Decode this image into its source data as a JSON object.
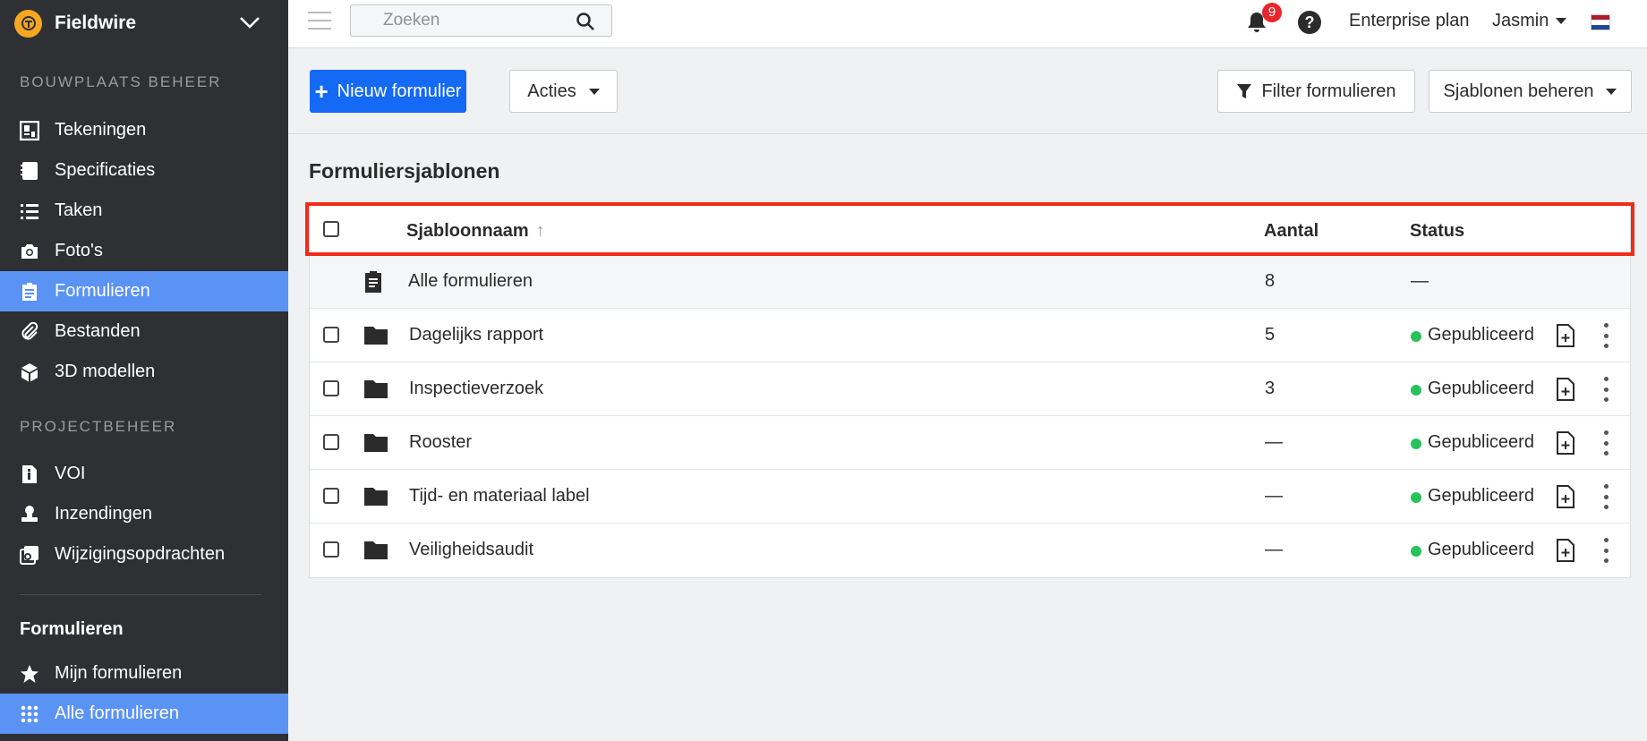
{
  "sidebar": {
    "brand": "Fieldwire",
    "section1": "BOUWPLAATS BEHEER",
    "items1": [
      {
        "label": "Tekeningen",
        "icon": "drawings-icon"
      },
      {
        "label": "Specificaties",
        "icon": "specs-icon"
      },
      {
        "label": "Taken",
        "icon": "list-icon"
      },
      {
        "label": "Foto's",
        "icon": "camera-icon"
      },
      {
        "label": "Formulieren",
        "icon": "clipboard-icon",
        "active": true
      },
      {
        "label": "Bestanden",
        "icon": "paperclip-icon"
      },
      {
        "label": "3D modellen",
        "icon": "cube-icon"
      }
    ],
    "section2": "PROJECTBEHEER",
    "items2": [
      {
        "label": "VOI",
        "icon": "info-doc-icon"
      },
      {
        "label": "Inzendingen",
        "icon": "stamp-icon"
      },
      {
        "label": "Wijzigingsopdrachten",
        "icon": "change-order-icon"
      }
    ],
    "subhead": "Formulieren",
    "items3": [
      {
        "label": "Mijn formulieren",
        "icon": "star-icon"
      },
      {
        "label": "Alle formulieren",
        "icon": "grid-icon",
        "active": true
      }
    ]
  },
  "topbar": {
    "search_placeholder": "Zoeken",
    "notifications": "9",
    "help": "?",
    "plan": "Enterprise plan",
    "user": "Jasmin"
  },
  "actions": {
    "new_form": "Nieuw formulier",
    "actions": "Acties",
    "filter": "Filter formulieren",
    "templates": "Sjablonen beheren"
  },
  "main": {
    "title": "Formuliersjablonen",
    "columns": {
      "name": "Sjabloonnaam",
      "count": "Aantal",
      "status": "Status"
    },
    "all_row": {
      "name": "Alle formulieren",
      "count": "8",
      "status": "—"
    },
    "rows": [
      {
        "name": "Dagelijks rapport",
        "count": "5",
        "status": "Gepubliceerd"
      },
      {
        "name": "Inspectieverzoek",
        "count": "3",
        "status": "Gepubliceerd"
      },
      {
        "name": "Rooster",
        "count": "—",
        "status": "Gepubliceerd"
      },
      {
        "name": "Tijd- en materiaal label",
        "count": "—",
        "status": "Gepubliceerd"
      },
      {
        "name": "Veiligheidsaudit",
        "count": "—",
        "status": "Gepubliceerd"
      }
    ]
  },
  "colors": {
    "sidebar": "#2f3033",
    "active": "#5b93f5",
    "primary": "#1469f5",
    "published": "#27c25b",
    "highlight": "#ef2b1a"
  }
}
